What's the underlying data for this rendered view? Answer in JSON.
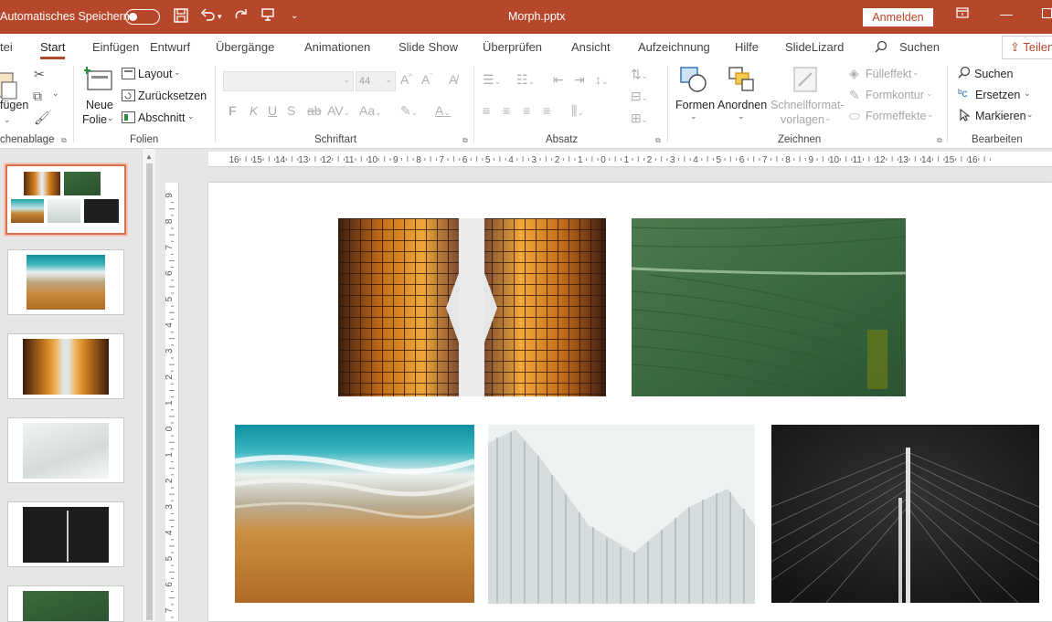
{
  "titlebar": {
    "autosave_label": "Automatisches Speichern",
    "file_name": "Morph.pptx",
    "signin_label": "Anmelden",
    "accent": "#b7472a"
  },
  "tabs": [
    {
      "label": "tei"
    },
    {
      "label": "Start"
    },
    {
      "label": "Einfügen"
    },
    {
      "label": "Entwurf"
    },
    {
      "label": "Übergänge"
    },
    {
      "label": "Animationen"
    },
    {
      "label": "Slide Show"
    },
    {
      "label": "Überprüfen"
    },
    {
      "label": "Ansicht"
    },
    {
      "label": "Aufzeichnung"
    },
    {
      "label": "Hilfe"
    },
    {
      "label": "SlideLizard"
    }
  ],
  "search_label": "Suchen",
  "share_label": "Teilen",
  "ribbon": {
    "clipboard": {
      "paste_label": "fügen",
      "group_label": "chenablage"
    },
    "slides": {
      "new_slide_line1": "Neue",
      "new_slide_line2": "Folie",
      "layout_label": "Layout",
      "reset_label": "Zurücksetzen",
      "section_label": "Abschnitt",
      "group_label": "Folien"
    },
    "font": {
      "font_name": "",
      "font_size": "44",
      "group_label": "Schriftart"
    },
    "paragraph": {
      "group_label": "Absatz"
    },
    "drawing": {
      "shapes_label": "Formen",
      "arrange_label": "Anordnen",
      "quick_styles_line1": "Schnellformat-",
      "quick_styles_line2": "vorlagen",
      "fill_label": "Fülleffekt",
      "outline_label": "Formkontur",
      "effects_label": "Formeffekte",
      "group_label": "Zeichnen"
    },
    "editing": {
      "find_label": "Suchen",
      "replace_label": "Ersetzen",
      "select_label": "Markieren",
      "group_label": "Bearbeiten"
    }
  },
  "ruler": {
    "horizontal": [
      "16",
      "15",
      "14",
      "13",
      "12",
      "11",
      "10",
      "9",
      "8",
      "7",
      "6",
      "5",
      "4",
      "3",
      "2",
      "1",
      "0",
      "1",
      "2",
      "3",
      "4",
      "5",
      "6",
      "7",
      "8",
      "9",
      "10",
      "11",
      "12",
      "13",
      "14",
      "15",
      "16"
    ],
    "vertical": [
      "9",
      "8",
      "7",
      "6",
      "5",
      "4",
      "3",
      "2",
      "1",
      "0",
      "1",
      "2",
      "3",
      "4",
      "5",
      "6",
      "7"
    ]
  },
  "thumbnails": [
    {
      "name": "collage",
      "selected": true
    },
    {
      "name": "beach",
      "selected": false
    },
    {
      "name": "buildings",
      "selected": false
    },
    {
      "name": "architecture",
      "selected": false
    },
    {
      "name": "bridge",
      "selected": false
    },
    {
      "name": "leaf",
      "selected": false
    }
  ]
}
